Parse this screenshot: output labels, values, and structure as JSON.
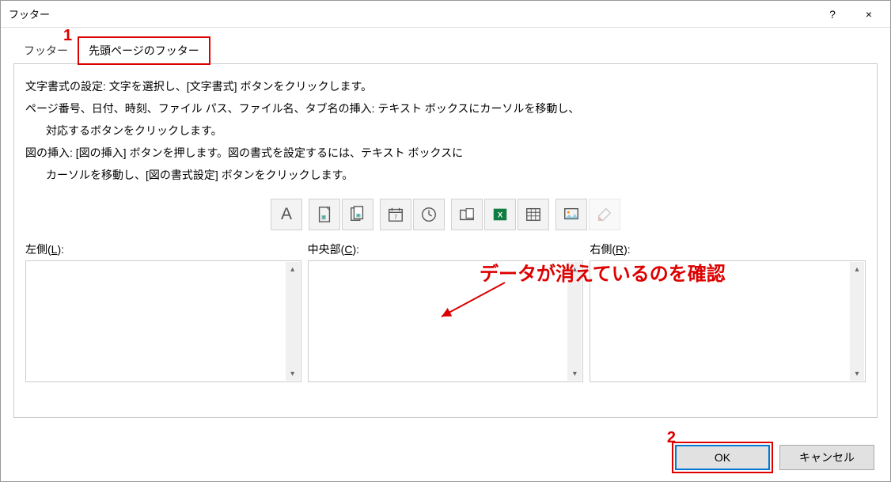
{
  "window": {
    "title": "フッター",
    "help_label": "?",
    "close_label": "×"
  },
  "tabs": {
    "tab1": "フッター",
    "tab2": "先頭ページのフッター"
  },
  "instructions": {
    "line1": "文字書式の設定: 文字を選択し、[文字書式] ボタンをクリックします。",
    "line2": "ページ番号、日付、時刻、ファイル パス、ファイル名、タブ名の挿入: テキスト ボックスにカーソルを移動し、",
    "line2b": "対応するボタンをクリックします。",
    "line3": "図の挿入: [図の挿入] ボタンを押します。図の書式を設定するには、テキスト ボックスに",
    "line3b": "カーソルを移動し、[図の書式設定] ボタンをクリックします。"
  },
  "toolbar": {
    "text_format": "A",
    "page_number": "page-number-icon",
    "page_total": "page-total-icon",
    "date": "date-icon",
    "time": "time-icon",
    "file_path": "file-path-icon",
    "file_name": "file-name-icon",
    "sheet_name": "sheet-name-icon",
    "picture": "picture-icon",
    "format_picture": "format-picture-icon"
  },
  "sections": {
    "left_label": "左側(",
    "left_key": "L",
    "left_suffix": "):",
    "center_label": "中央部(",
    "center_key": "C",
    "center_suffix": "):",
    "right_label": "右側(",
    "right_key": "R",
    "right_suffix": "):",
    "left_value": "",
    "center_value": "",
    "right_value": ""
  },
  "buttons": {
    "ok": "OK",
    "cancel": "キャンセル"
  },
  "annotations": {
    "num1": "1",
    "num2": "2",
    "confirm_text": "データが消えているのを確認"
  }
}
